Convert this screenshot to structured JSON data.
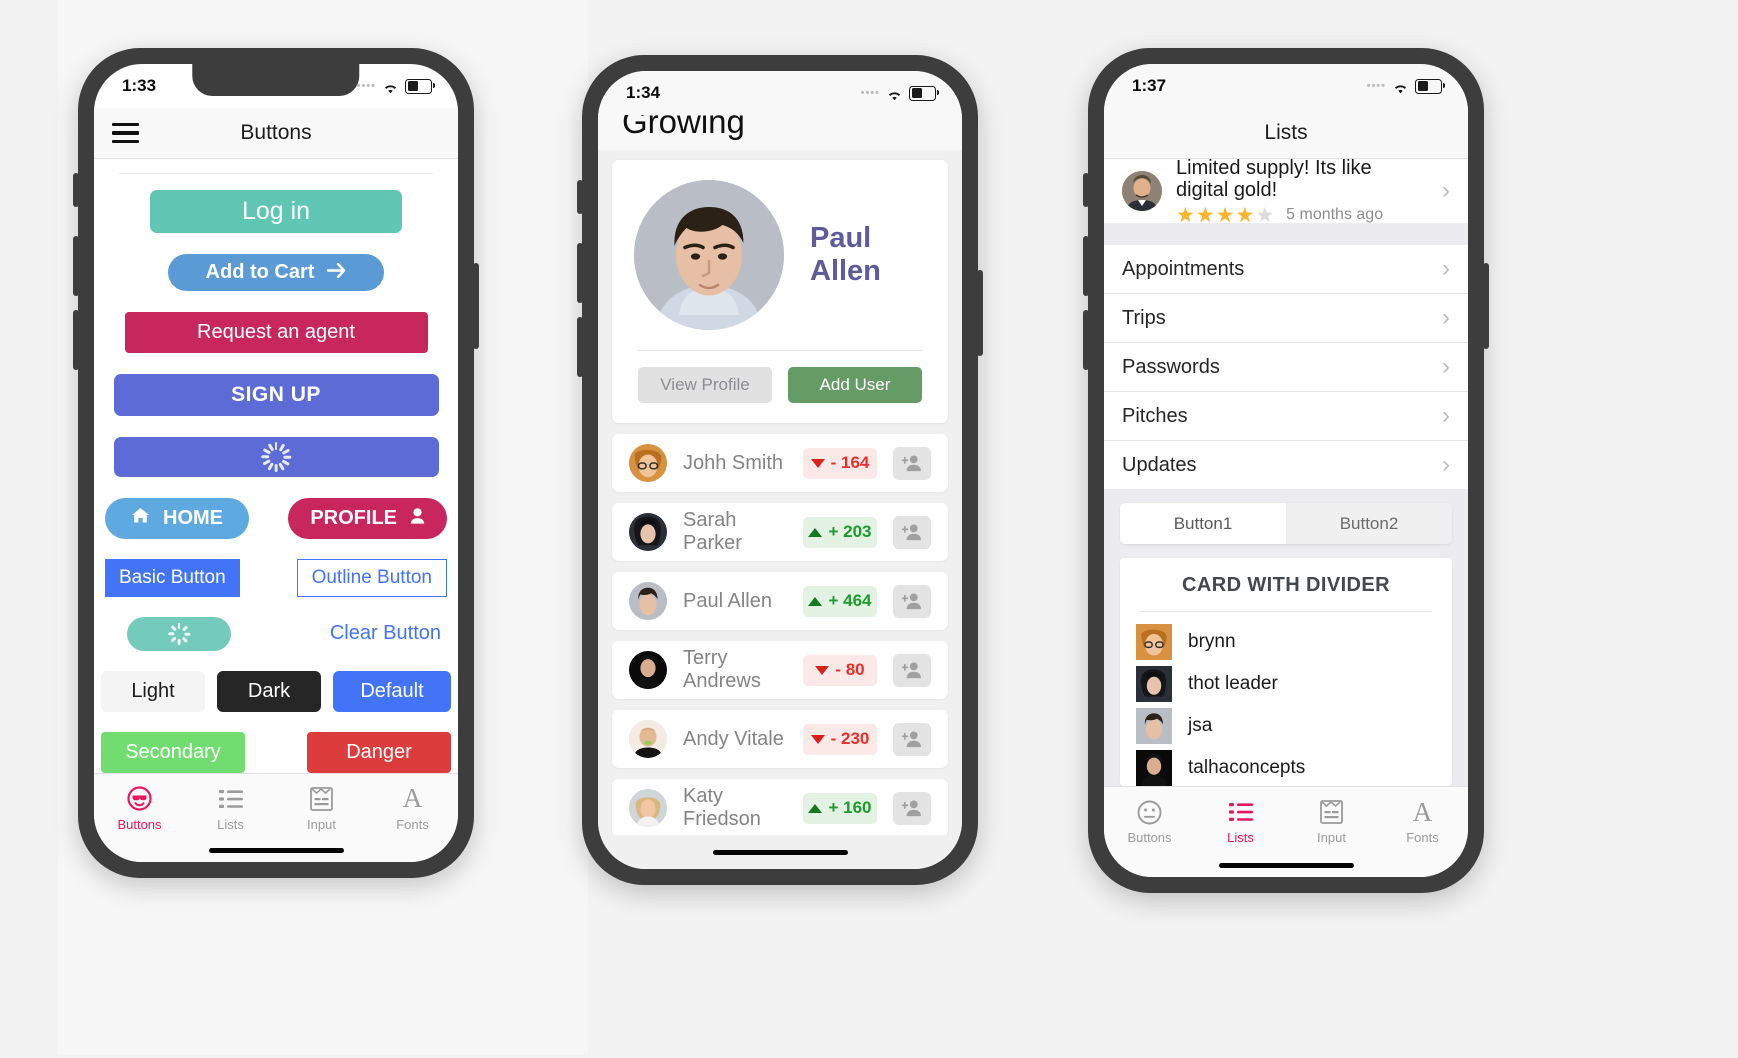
{
  "phone1": {
    "status": {
      "time": "1:33",
      "wifi": "wifi-icon",
      "battery": "battery-icon"
    },
    "nav": {
      "menu": "hamburger-icon",
      "title": "Buttons"
    },
    "buttons": {
      "login": "Log in",
      "add_to_cart": "Add to Cart",
      "request_agent": "Request an agent",
      "sign_up": "SIGN UP",
      "loading_wide": "",
      "home": "HOME",
      "profile": "PROFILE",
      "basic": "Basic Button",
      "outline": "Outline Button",
      "teal_loading": "",
      "clear": "Clear Button",
      "light": "Light",
      "dark": "Dark",
      "default": "Default",
      "secondary": "Secondary",
      "danger": "Danger"
    },
    "tabs": [
      {
        "label": "Buttons",
        "icon": "smiley-sunglasses-icon",
        "active": true
      },
      {
        "label": "Lists",
        "icon": "list-icon",
        "active": false
      },
      {
        "label": "Input",
        "icon": "form-icon",
        "active": false
      },
      {
        "label": "Fonts",
        "icon": "letter-a-icon",
        "active": false
      }
    ]
  },
  "phone2": {
    "status": {
      "time": "1:34"
    },
    "title": "Growing",
    "profile": {
      "name": "Paul Allen",
      "view_profile": "View Profile",
      "add_user": "Add User"
    },
    "users": [
      {
        "name": "Johh Smith",
        "delta": "- 164",
        "dir": "down"
      },
      {
        "name": "Sarah Parker",
        "delta": "+ 203",
        "dir": "up"
      },
      {
        "name": "Paul Allen",
        "delta": "+ 464",
        "dir": "up"
      },
      {
        "name": "Terry Andrews",
        "delta": "- 80",
        "dir": "down"
      },
      {
        "name": "Andy Vitale",
        "delta": "- 230",
        "dir": "down"
      },
      {
        "name": "Katy Friedson",
        "delta": "+ 160",
        "dir": "up"
      }
    ]
  },
  "phone3": {
    "status": {
      "time": "1:37"
    },
    "nav": {
      "title": "Lists"
    },
    "review": {
      "title": "Limited supply! Its like digital gold!",
      "rating": 4,
      "rating_max": 5,
      "time": "5 months ago"
    },
    "list_items": [
      "Appointments",
      "Trips",
      "Passwords",
      "Pitches",
      "Updates"
    ],
    "segmented": {
      "selected": "Button1",
      "options": [
        "Button1",
        "Button2"
      ]
    },
    "card": {
      "title": "CARD WITH DIVIDER",
      "entries": [
        "brynn",
        "thot leader",
        "jsa",
        "talhaconcepts"
      ]
    },
    "tabs": [
      {
        "label": "Buttons",
        "icon": "smiley-icon",
        "active": false
      },
      {
        "label": "Lists",
        "icon": "list-icon",
        "active": true
      },
      {
        "label": "Input",
        "icon": "form-icon",
        "active": false
      },
      {
        "label": "Fonts",
        "icon": "letter-a-icon",
        "active": false
      }
    ]
  },
  "colors": {
    "accent_pink": "#e8175d",
    "teal": "#60c6b4",
    "blue": "#5b9bd5",
    "crimson": "#c7275d",
    "purple": "#5c6bd6",
    "primary_blue": "#4374f7",
    "green": "#71dd70",
    "red": "#dc3c3c",
    "add_user_green": "#659b65",
    "profile_name": "#5d5a9e",
    "star_gold": "#f9b52c"
  }
}
